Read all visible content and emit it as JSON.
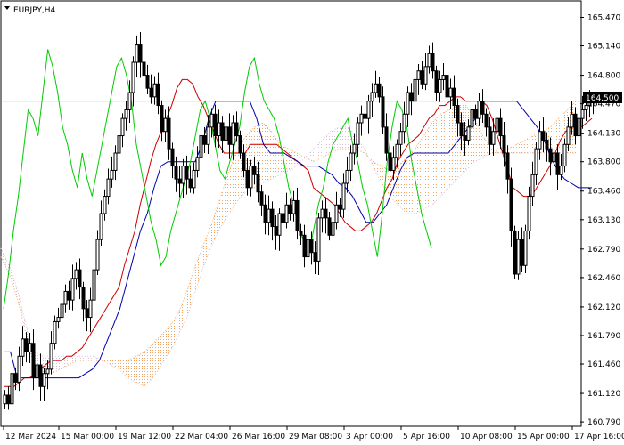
{
  "header": {
    "symbol_label": "EURJPY,H4",
    "menu_icon": "triangle-down-icon"
  },
  "colors": {
    "background": "#ffffff",
    "frame": "#000000",
    "candle": "#000000",
    "tenkan": "#cc0000",
    "kijun": "#0000aa",
    "chikou": "#00cc00",
    "kumo_bull": "#f4a460",
    "kumo_bear": "#d8bfd8",
    "current_line": "#c0c0c0",
    "price_tag_bg": "#000000",
    "price_tag_fg": "#ffffff"
  },
  "chart_data": {
    "type": "candlestick",
    "indicator": "Ichimoku Kinko Hyo",
    "symbol": "EURJPY",
    "timeframe": "H4",
    "ylim": [
      160.75,
      165.65
    ],
    "y_ticks": [
      "165.470",
      "165.140",
      "164.800",
      "164.470",
      "164.130",
      "163.800",
      "163.460",
      "163.130",
      "162.790",
      "162.460",
      "162.120",
      "161.790",
      "161.460",
      "161.120",
      "160.790"
    ],
    "x_ticks": [
      "12 Mar 2024",
      "15 Mar 00:00",
      "19 Mar 12:00",
      "22 Mar 04:00",
      "26 Mar 16:00",
      "29 Mar 08:00",
      "3 Apr 00:00",
      "5 Apr 16:00",
      "10 Apr 08:00",
      "15 Apr 00:00",
      "17 Apr 16:00"
    ],
    "current_price": "164.500",
    "current_price_value": 164.5,
    "close": [
      161.1,
      161.0,
      161.35,
      161.25,
      161.55,
      161.75,
      161.6,
      161.7,
      161.3,
      161.45,
      161.2,
      161.35,
      161.4,
      161.7,
      161.95,
      162.0,
      162.15,
      162.3,
      162.2,
      162.45,
      162.55,
      162.35,
      162.1,
      162.0,
      162.2,
      162.55,
      162.9,
      163.2,
      163.4,
      163.6,
      163.7,
      163.9,
      164.1,
      164.3,
      164.4,
      164.6,
      164.95,
      165.15,
      164.95,
      164.8,
      164.65,
      164.55,
      164.7,
      164.45,
      164.15,
      164.3,
      163.95,
      163.75,
      163.6,
      163.55,
      163.75,
      163.6,
      163.5,
      163.7,
      163.85,
      164.1,
      164.0,
      164.2,
      164.35,
      164.1,
      164.25,
      164.05,
      164.2,
      164.0,
      164.25,
      164.1,
      163.9,
      163.7,
      163.5,
      163.75,
      163.65,
      163.45,
      163.3,
      163.1,
      163.25,
      163.05,
      162.95,
      163.2,
      163.1,
      163.3,
      163.2,
      163.35,
      163.0,
      162.95,
      162.7,
      162.9,
      162.75,
      162.65,
      163.15,
      163.25,
      163.15,
      162.95,
      163.1,
      163.3,
      163.25,
      163.55,
      163.7,
      163.9,
      164.0,
      164.25,
      164.35,
      164.3,
      164.5,
      164.6,
      164.7,
      164.55,
      164.2,
      163.9,
      163.7,
      163.85,
      164.0,
      164.15,
      164.35,
      164.6,
      164.5,
      164.75,
      164.85,
      164.7,
      164.9,
      165.05,
      164.85,
      164.6,
      164.75,
      164.8,
      164.55,
      164.65,
      164.45,
      164.25,
      164.1,
      164.05,
      164.2,
      164.4,
      164.3,
      164.5,
      164.35,
      164.2,
      164.0,
      164.15,
      164.3,
      164.1,
      163.9,
      163.6,
      163.0,
      162.5,
      162.9,
      162.6,
      163.0,
      163.4,
      163.65,
      163.95,
      164.15,
      164.05,
      163.95,
      163.8,
      163.9,
      163.65,
      163.75,
      164.0,
      164.2,
      164.35,
      164.1,
      164.3,
      164.4,
      164.45,
      164.5,
      164.55
    ],
    "tenkan": [
      161.2,
      161.2,
      161.2,
      161.25,
      161.3,
      161.3,
      161.35,
      161.4,
      161.45,
      161.5,
      161.5,
      161.5,
      161.55,
      161.55,
      161.6,
      161.65,
      161.75,
      161.85,
      161.95,
      162.05,
      162.15,
      162.25,
      162.35,
      162.6,
      162.8,
      163.0,
      163.3,
      163.55,
      163.8,
      164.0,
      164.15,
      164.3,
      164.45,
      164.65,
      164.75,
      164.75,
      164.7,
      164.55,
      164.45,
      164.3,
      164.15,
      164.0,
      163.9,
      163.9,
      163.9,
      163.9,
      163.9,
      164.0,
      164.0,
      164.0,
      164.0,
      164.0,
      164.0,
      163.95,
      163.9,
      163.85,
      163.8,
      163.75,
      163.7,
      163.5,
      163.45,
      163.4,
      163.35,
      163.3,
      163.2,
      163.1,
      163.05,
      163.0,
      163.0,
      163.05,
      163.1,
      163.2,
      163.35,
      163.5,
      163.6,
      163.8,
      163.9,
      164.0,
      164.05,
      164.1,
      164.2,
      164.3,
      164.35,
      164.45,
      164.45,
      164.5,
      164.55,
      164.55,
      164.5,
      164.5,
      164.5,
      164.5,
      164.45,
      164.3,
      164.1,
      163.9,
      163.7,
      163.5,
      163.45,
      163.4,
      163.4,
      163.45,
      163.55,
      163.65,
      163.75,
      163.9,
      164.05,
      164.15,
      164.2,
      164.2,
      164.2,
      164.25,
      164.3
    ],
    "kijun": [
      161.6,
      161.6,
      161.3,
      161.3,
      161.3,
      161.3,
      161.3,
      161.3,
      161.3,
      161.3,
      161.3,
      161.3,
      161.35,
      161.4,
      161.5,
      161.7,
      161.9,
      162.1,
      162.4,
      162.7,
      163.0,
      163.2,
      163.5,
      163.75,
      163.8,
      163.8,
      163.8,
      163.8,
      163.8,
      164.0,
      164.3,
      164.5,
      164.5,
      164.5,
      164.5,
      164.5,
      164.5,
      164.3,
      164.0,
      163.9,
      163.9,
      163.9,
      163.85,
      163.8,
      163.75,
      163.75,
      163.75,
      163.7,
      163.65,
      163.55,
      163.5,
      163.4,
      163.25,
      163.1,
      163.1,
      163.2,
      163.3,
      163.5,
      163.7,
      163.85,
      163.9,
      163.9,
      163.9,
      163.9,
      163.9,
      163.9,
      164.0,
      164.1,
      164.2,
      164.3,
      164.5,
      164.5,
      164.5,
      164.5,
      164.5,
      164.5,
      164.4,
      164.3,
      164.2,
      164.05,
      163.85,
      163.7,
      163.6,
      163.55,
      163.5,
      163.5,
      163.5
    ],
    "chikou": [
      162.1,
      162.5,
      163.0,
      163.4,
      163.9,
      164.4,
      164.3,
      164.1,
      164.6,
      165.1,
      164.9,
      164.6,
      164.2,
      164.0,
      163.7,
      163.5,
      163.9,
      163.6,
      163.4,
      163.7,
      164.0,
      164.3,
      164.6,
      164.9,
      165.0,
      164.8,
      164.5,
      164.0,
      163.7,
      163.4,
      163.1,
      162.9,
      162.6,
      162.7,
      163.0,
      163.2,
      163.4,
      163.6,
      163.8,
      164.1,
      164.4,
      164.5,
      164.3,
      164.0,
      163.7,
      163.6,
      163.8,
      164.0,
      164.2,
      164.6,
      164.9,
      165.0,
      164.7,
      164.5,
      164.4,
      164.3,
      164.1,
      163.8,
      163.5,
      163.3,
      163.0,
      162.9,
      162.7,
      163.0,
      163.3,
      163.5,
      163.8,
      164.0,
      164.1,
      164.2,
      164.3,
      164.0,
      163.8,
      163.5,
      163.3,
      163.0,
      162.7,
      163.2,
      163.8,
      164.2,
      164.5,
      164.4,
      164.2,
      163.8,
      163.5,
      163.2,
      163.0,
      162.8
    ],
    "senkou_a": [
      162.7,
      162.5,
      162.2,
      161.8,
      161.4,
      161.3,
      161.35,
      161.4,
      161.45,
      161.5,
      161.5,
      161.5,
      161.5,
      161.5,
      161.5,
      161.5,
      161.55,
      161.6,
      161.7,
      161.8,
      161.9,
      162.05,
      162.3,
      162.6,
      162.85,
      163.1,
      163.4,
      163.7,
      163.95,
      164.1,
      164.2,
      164.25,
      164.15,
      164.0,
      163.95,
      163.9,
      163.85,
      163.8,
      163.85,
      163.9,
      163.95,
      163.95,
      163.95,
      163.9,
      163.8,
      163.75,
      163.7,
      163.75,
      163.85,
      163.95,
      164.1,
      164.25,
      164.35,
      164.4,
      164.45,
      164.45,
      164.3,
      164.1,
      163.95,
      163.9,
      163.95,
      164.0,
      164.05,
      164.1,
      164.15,
      164.2,
      164.3,
      164.4,
      164.5
    ],
    "senkou_b": [
      162.8,
      162.6,
      162.3,
      161.9,
      161.6,
      161.55,
      161.55,
      161.55,
      161.55,
      161.55,
      161.55,
      161.55,
      161.5,
      161.45,
      161.4,
      161.3,
      161.25,
      161.2,
      161.3,
      161.45,
      161.6,
      161.8,
      162.0,
      162.3,
      162.6,
      162.85,
      163.05,
      163.2,
      163.35,
      163.45,
      163.5,
      163.55,
      163.6,
      163.65,
      163.7,
      163.75,
      163.85,
      163.95,
      164.05,
      164.15,
      164.2,
      164.2,
      164.1,
      163.95,
      163.75,
      163.55,
      163.4,
      163.3,
      163.2,
      163.2,
      163.25,
      163.3,
      163.4,
      163.5,
      163.6,
      163.7,
      163.8,
      163.85,
      163.9,
      163.9,
      163.9,
      163.9,
      163.9,
      163.9,
      163.9,
      163.9,
      163.9,
      163.9,
      163.9
    ]
  }
}
